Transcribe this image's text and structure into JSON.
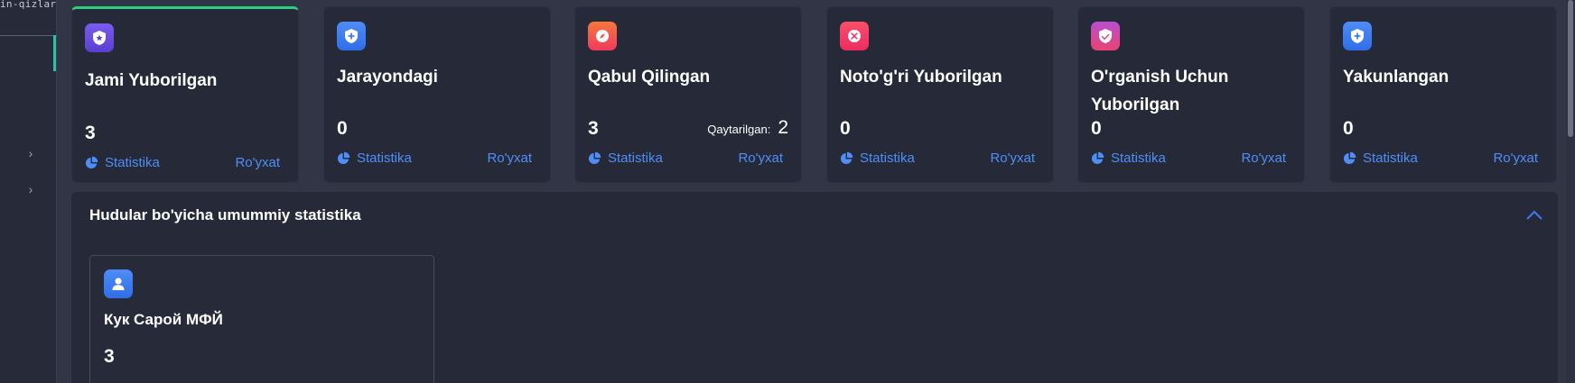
{
  "sidebar": {
    "code_fragment": "in-qizlar"
  },
  "cards": [
    {
      "title": "Jami Yuborilgan",
      "count": "3",
      "stats_label": "Statistika",
      "list_label": "Ro'yxat",
      "icon": "shield-star-icon",
      "color": "#6b4fe0"
    },
    {
      "title": "Jarayondagi",
      "count": "0",
      "stats_label": "Statistika",
      "list_label": "Ro'yxat",
      "icon": "shield-plus-icon",
      "color": "#3a7bf0"
    },
    {
      "title": "Qabul Qilingan",
      "count": "3",
      "returned_label": "Qaytarilgan:",
      "returned_value": "2",
      "stats_label": "Statistika",
      "list_label": "Ro'yxat",
      "icon": "compass-icon",
      "color": "#f0504e"
    },
    {
      "title": "Noto'g'ri Yuborilgan",
      "count": "0",
      "stats_label": "Statistika",
      "list_label": "Ro'yxat",
      "icon": "close-circle-icon",
      "color": "#f0376b"
    },
    {
      "title": "O'rganish Uchun Yuborilgan",
      "count": "0",
      "stats_label": "Statistika",
      "list_label": "Ro'yxat",
      "icon": "shield-check-icon",
      "color": "#d9437e"
    },
    {
      "title": "Yakunlangan",
      "count": "0",
      "stats_label": "Statistika",
      "list_label": "Ro'yxat",
      "icon": "shield-plus-icon",
      "color": "#3a7bf0"
    }
  ],
  "region": {
    "title": "Hudular bo'yicha umummiy statistika",
    "items": [
      {
        "name": "Кук Сарой МФЙ",
        "count": "3",
        "icon": "user-icon"
      }
    ]
  }
}
